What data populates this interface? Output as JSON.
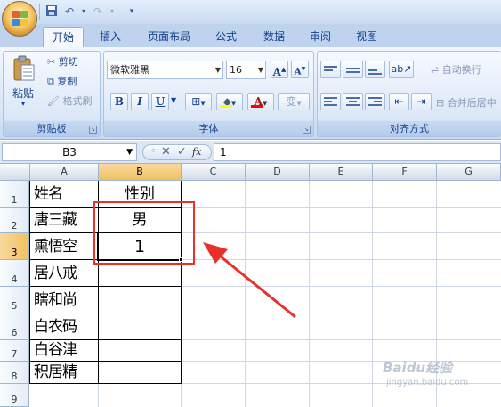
{
  "tabs": [
    "开始",
    "插入",
    "页面布局",
    "公式",
    "数据",
    "审阅",
    "视图"
  ],
  "clipboard": {
    "paste": "粘贴",
    "cut": "剪切",
    "copy": "复制",
    "format_painter": "格式刷",
    "label": "剪贴板"
  },
  "font": {
    "name": "微软雅黑",
    "size": "16",
    "bold": "B",
    "italic": "I",
    "underline": "U",
    "label": "字体",
    "grow": "A",
    "shrink": "A",
    "color_a": "A",
    "phonetic": "变"
  },
  "alignment": {
    "wrap_text": "自动换行",
    "merge_center": "合并后居中",
    "label": "对齐方式"
  },
  "formula_bar": {
    "name_box": "B3",
    "formula": "1",
    "fx": "fx"
  },
  "columns": [
    "A",
    "B",
    "C",
    "D",
    "E",
    "F",
    "G"
  ],
  "rows": [
    "1",
    "2",
    "3",
    "4",
    "5",
    "6",
    "7",
    "8",
    "9"
  ],
  "cells": {
    "A": [
      "姓名",
      "唐三藏",
      "熏悟空",
      "居八戒",
      "瞎和尚",
      "白农码",
      "白谷津",
      "积居精"
    ],
    "B": [
      "性别",
      "男",
      "1",
      "",
      "",
      "",
      "",
      ""
    ]
  },
  "watermark": {
    "brand": "Baidu经验",
    "url": "jingyan.baidu.com"
  },
  "colors": {
    "annotation": "#e8312b",
    "selection": "#000000",
    "header_selected": "#f1c15f"
  }
}
